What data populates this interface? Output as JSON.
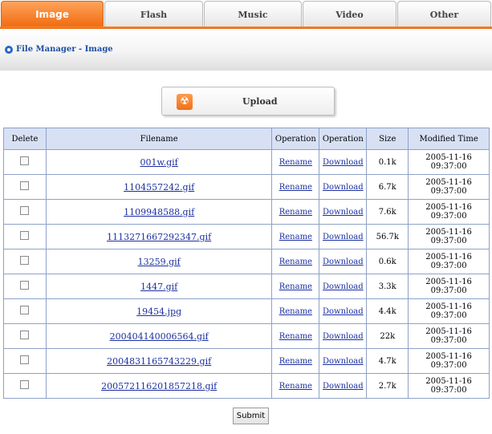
{
  "tabs": [
    {
      "label": "Image",
      "active": true
    },
    {
      "label": "Flash",
      "active": false
    },
    {
      "label": "Music",
      "active": false
    },
    {
      "label": "Video",
      "active": false
    },
    {
      "label": "Other",
      "active": false
    }
  ],
  "breadcrumb": "File Manager - Image",
  "upload_label": "Upload",
  "table": {
    "headers": [
      "Delete",
      "Filename",
      "Operation",
      "Operation",
      "Size",
      "Modified Time"
    ],
    "rename_label": "Rename",
    "download_label": "Download",
    "rows": [
      {
        "filename": "001w.gif",
        "size": "0.1k",
        "modified": "2005-11-16 09:37:00"
      },
      {
        "filename": "1104557242.gif",
        "size": "6.7k",
        "modified": "2005-11-16 09:37:00"
      },
      {
        "filename": "1109948588.gif",
        "size": "7.6k",
        "modified": "2005-11-16 09:37:00"
      },
      {
        "filename": "1113271667292347.gif",
        "size": "56.7k",
        "modified": "2005-11-16 09:37:00"
      },
      {
        "filename": "13259.gif",
        "size": "0.6k",
        "modified": "2005-11-16 09:37:00"
      },
      {
        "filename": "1447.gif",
        "size": "3.3k",
        "modified": "2005-11-16 09:37:00"
      },
      {
        "filename": "19454.jpg",
        "size": "4.4k",
        "modified": "2005-11-16 09:37:00"
      },
      {
        "filename": "200404140006564.gif",
        "size": "22k",
        "modified": "2005-11-16 09:37:00"
      },
      {
        "filename": "2004831165743229.gif",
        "size": "4.7k",
        "modified": "2005-11-16 09:37:00"
      },
      {
        "filename": "200572116201857218.gif",
        "size": "2.7k",
        "modified": "2005-11-16 09:37:00"
      }
    ]
  },
  "submit_label": "Submit",
  "colors": {
    "accent": "#f07018",
    "link": "#1b2fa0",
    "header_bg": "#d8e1f4"
  }
}
